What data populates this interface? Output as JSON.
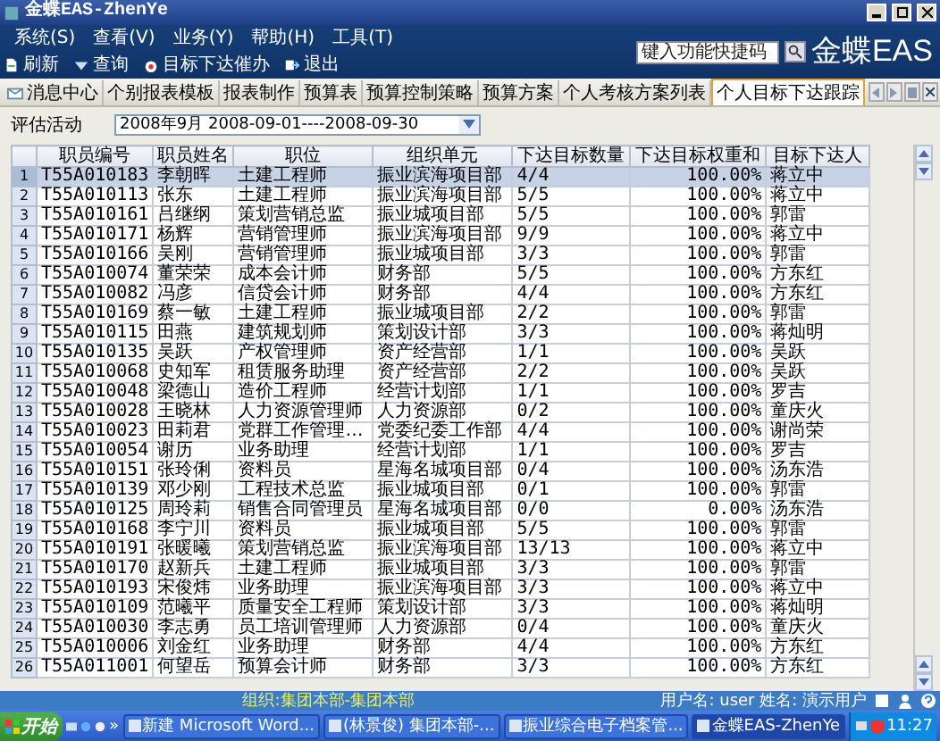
{
  "window": {
    "title": "金蝶EAS-ZhenYe"
  },
  "menu": [
    "系统(S)",
    "查看(V)",
    "业务(Y)",
    "帮助(H)",
    "工具(T)"
  ],
  "search": {
    "placeholder": "键入功能快捷码"
  },
  "logo": "金蝶EAS",
  "toolbar": [
    {
      "kind": "refresh",
      "label": "刷新"
    },
    {
      "kind": "query",
      "label": "查询"
    },
    {
      "kind": "remind",
      "label": "目标下达催办"
    },
    {
      "kind": "exit",
      "label": "退出"
    }
  ],
  "tabs": [
    {
      "label": "消息中心",
      "selected": false
    },
    {
      "label": "个别报表模板",
      "selected": false
    },
    {
      "label": "报表制作",
      "selected": false
    },
    {
      "label": "预算表",
      "selected": false
    },
    {
      "label": "预算控制策略",
      "selected": false
    },
    {
      "label": "预算方案",
      "selected": false
    },
    {
      "label": "个人考核方案列表",
      "selected": false
    },
    {
      "label": "个人目标下达跟踪",
      "selected": true
    }
  ],
  "filter": {
    "label": "评估活动",
    "value": "2008年9月 2008-09-01----2008-09-30"
  },
  "table": {
    "columns": [
      "职员编号",
      "职员姓名",
      "职位",
      "组织单元",
      "下达目标数量",
      "下达目标权重和",
      "目标下达人"
    ],
    "rows": [
      {
        "number": "1",
        "selected": true,
        "cells": [
          "T55A010183",
          "李朝晖",
          "土建工程师",
          "振业滨海项目部",
          "4/4",
          "100.00%",
          "蒋立中"
        ]
      },
      {
        "number": "2",
        "selected": false,
        "cells": [
          "T55A010113",
          "张东",
          "土建工程师",
          "振业滨海项目部",
          "5/5",
          "100.00%",
          "蒋立中"
        ]
      },
      {
        "number": "3",
        "selected": false,
        "cells": [
          "T55A010161",
          "吕继纲",
          "策划营销总监",
          "振业城项目部",
          "5/5",
          "100.00%",
          "郭雷"
        ]
      },
      {
        "number": "4",
        "selected": false,
        "cells": [
          "T55A010171",
          "杨辉",
          "营销管理师",
          "振业滨海项目部",
          "9/9",
          "100.00%",
          "蒋立中"
        ]
      },
      {
        "number": "5",
        "selected": false,
        "cells": [
          "T55A010166",
          "吴刚",
          "营销管理师",
          "振业城项目部",
          "3/3",
          "100.00%",
          "郭雷"
        ]
      },
      {
        "number": "6",
        "selected": false,
        "cells": [
          "T55A010074",
          "董荣荣",
          "成本会计师",
          "财务部",
          "5/5",
          "100.00%",
          "方东红"
        ]
      },
      {
        "number": "7",
        "selected": false,
        "cells": [
          "T55A010082",
          "冯彦",
          "信贷会计师",
          "财务部",
          "4/4",
          "100.00%",
          "方东红"
        ]
      },
      {
        "number": "8",
        "selected": false,
        "cells": [
          "T55A010169",
          "蔡一敏",
          "土建工程师",
          "振业城项目部",
          "2/2",
          "100.00%",
          "郭雷"
        ]
      },
      {
        "number": "9",
        "selected": false,
        "cells": [
          "T55A010115",
          "田燕",
          "建筑规划师",
          "策划设计部",
          "3/3",
          "100.00%",
          "蒋灿明"
        ]
      },
      {
        "number": "10",
        "selected": false,
        "cells": [
          "T55A010135",
          "吴跃",
          "产权管理师",
          "资产经营部",
          "1/1",
          "100.00%",
          "吴跃"
        ]
      },
      {
        "number": "11",
        "selected": false,
        "cells": [
          "T55A010068",
          "史知军",
          "租赁服务助理",
          "资产经营部",
          "2/2",
          "100.00%",
          "吴跃"
        ]
      },
      {
        "number": "12",
        "selected": false,
        "cells": [
          "T55A010048",
          "梁德山",
          "造价工程师",
          "经营计划部",
          "1/1",
          "100.00%",
          "罗吉"
        ]
      },
      {
        "number": "13",
        "selected": false,
        "cells": [
          "T55A010028",
          "王晓林",
          "人力资源管理师",
          "人力资源部",
          "0/2",
          "100.00%",
          "童庆火"
        ]
      },
      {
        "number": "14",
        "selected": false,
        "cells": [
          "T55A010023",
          "田莉君",
          "党群工作管理…",
          "党委纪委工作部",
          "4/4",
          "100.00%",
          "谢尚荣"
        ]
      },
      {
        "number": "15",
        "selected": false,
        "cells": [
          "T55A010054",
          "谢历",
          "业务助理",
          "经营计划部",
          "1/1",
          "100.00%",
          "罗吉"
        ]
      },
      {
        "number": "16",
        "selected": false,
        "cells": [
          "T55A010151",
          "张玲俐",
          "资料员",
          "星海名城项目部",
          "0/4",
          "100.00%",
          "汤东浩"
        ]
      },
      {
        "number": "17",
        "selected": false,
        "cells": [
          "T55A010139",
          "邓少刚",
          "工程技术总监",
          "振业城项目部",
          "0/1",
          "100.00%",
          "郭雷"
        ]
      },
      {
        "number": "18",
        "selected": false,
        "cells": [
          "T55A010125",
          "周玲莉",
          "销售合同管理员",
          "星海名城项目部",
          "0/0",
          "0.00%",
          "汤东浩"
        ]
      },
      {
        "number": "19",
        "selected": false,
        "cells": [
          "T55A010168",
          "李宁川",
          "资料员",
          "振业城项目部",
          "5/5",
          "100.00%",
          "郭雷"
        ]
      },
      {
        "number": "20",
        "selected": false,
        "cells": [
          "T55A010191",
          "张暖曦",
          "策划营销总监",
          "振业滨海项目部",
          "13/13",
          "100.00%",
          "蒋立中"
        ]
      },
      {
        "number": "21",
        "selected": false,
        "cells": [
          "T55A010170",
          "赵新兵",
          "土建工程师",
          "振业城项目部",
          "3/3",
          "100.00%",
          "郭雷"
        ]
      },
      {
        "number": "22",
        "selected": false,
        "cells": [
          "T55A010193",
          "宋俊炜",
          "业务助理",
          "振业滨海项目部",
          "3/3",
          "100.00%",
          "蒋立中"
        ]
      },
      {
        "number": "23",
        "selected": false,
        "cells": [
          "T55A010109",
          "范曦平",
          "质量安全工程师",
          "策划设计部",
          "3/3",
          "100.00%",
          "蒋灿明"
        ]
      },
      {
        "number": "24",
        "selected": false,
        "cells": [
          "T55A010030",
          "李志勇",
          "员工培训管理师",
          "人力资源部",
          "0/4",
          "100.00%",
          "童庆火"
        ]
      },
      {
        "number": "25",
        "selected": false,
        "cells": [
          "T55A010006",
          "刘金红",
          "业务助理",
          "财务部",
          "4/4",
          "100.00%",
          "方东红"
        ]
      },
      {
        "number": "26",
        "selected": false,
        "cells": [
          "T55A011001",
          "何望岳",
          "预算会计师",
          "财务部",
          "3/3",
          "100.00%",
          "方东红"
        ]
      }
    ]
  },
  "status_bar": {
    "organization": "组织:集团本部-集团本部",
    "user": "用户名: user 姓名: 演示用户"
  },
  "taskbar": {
    "start": "开始",
    "more": "»",
    "tasks": [
      {
        "label": "新建 Microsoft Word...",
        "selected": false
      },
      {
        "label": "(林景俊) 集团本部-...",
        "selected": false
      },
      {
        "label": "振业综合电子档案管...",
        "selected": false
      },
      {
        "label": "金蝶EAS-ZhenYe",
        "selected": true
      }
    ],
    "clock": "11:27"
  }
}
